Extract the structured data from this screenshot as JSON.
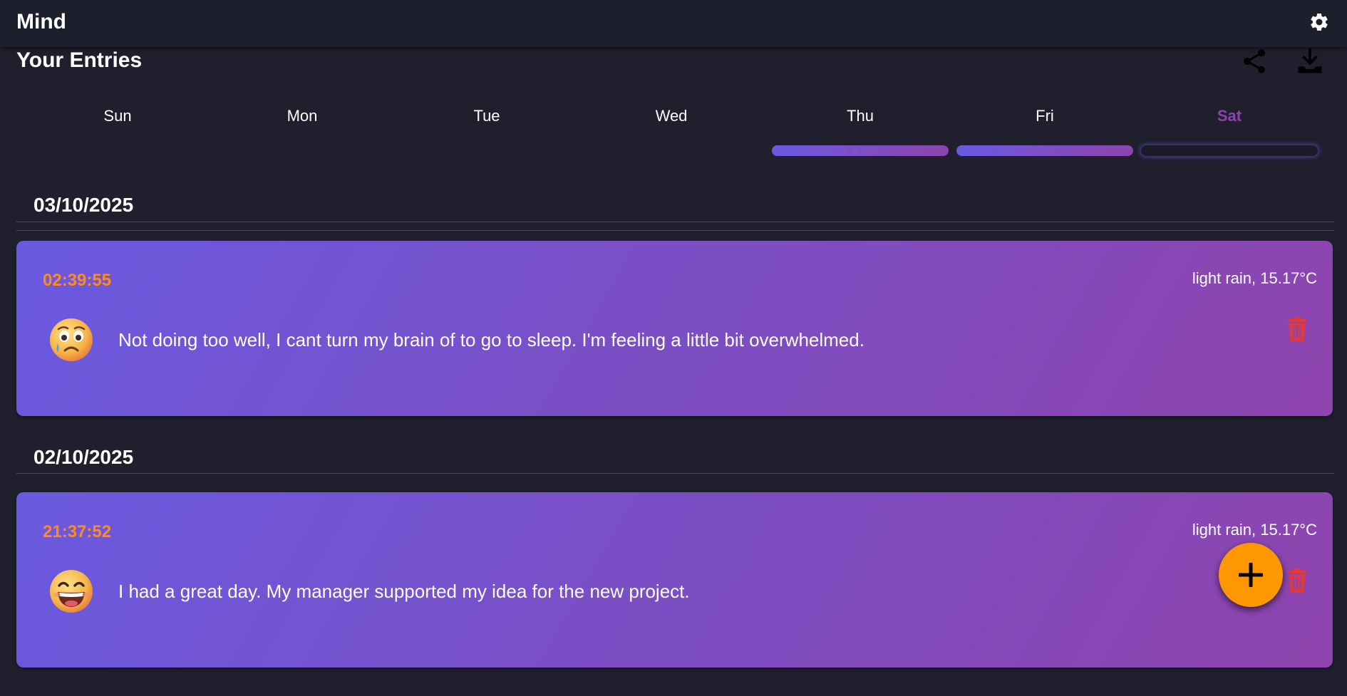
{
  "app": {
    "title": "Mind"
  },
  "toolbar": {
    "settings_icon": "gear-icon",
    "share_icon": "share-icon",
    "download_icon": "download-icon"
  },
  "entries_section": {
    "title": "Your Entries"
  },
  "week": {
    "days": [
      {
        "label": "Sun",
        "has_entry": false,
        "active": false
      },
      {
        "label": "Mon",
        "has_entry": false,
        "active": false
      },
      {
        "label": "Tue",
        "has_entry": false,
        "active": false
      },
      {
        "label": "Wed",
        "has_entry": false,
        "active": false
      },
      {
        "label": "Thu",
        "has_entry": true,
        "active": false
      },
      {
        "label": "Fri",
        "has_entry": true,
        "active": false
      },
      {
        "label": "Sat",
        "has_entry": false,
        "active": true
      }
    ]
  },
  "groups": [
    {
      "date": "03/10/2025",
      "entries": [
        {
          "time": "02:39:55",
          "weather": "light rain, 15.17°C",
          "mood_icon": "worried-face-icon",
          "text": "Not doing too well, I cant turn my brain of to go to sleep. I'm feeling a little bit overwhelmed."
        }
      ]
    },
    {
      "date": "02/10/2025",
      "entries": [
        {
          "time": "21:37:52",
          "weather": "light rain, 15.17°C",
          "mood_icon": "grinning-face-icon",
          "text": "I had a great day. My manager supported my idea for the new project."
        }
      ]
    }
  ],
  "fab": {
    "icon": "plus-icon"
  },
  "colors": {
    "background": "#1f1f2e",
    "gradient_start": "#6a5ae0",
    "gradient_end": "#8e44ad",
    "time_accent": "#ff8c1a",
    "delete": "#e53935",
    "fab": "#ff9800",
    "active_day": "#8e44ad"
  }
}
